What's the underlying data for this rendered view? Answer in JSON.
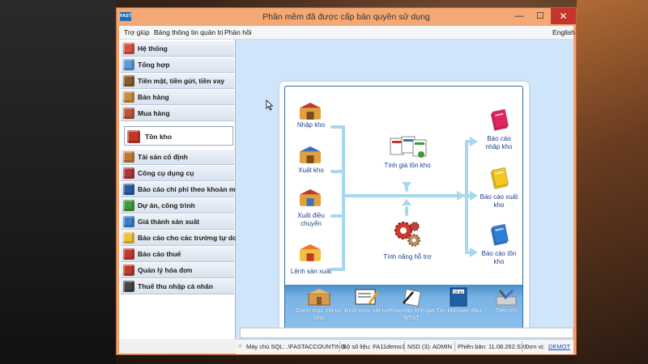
{
  "window": {
    "title": "Phần mềm đã được cấp bản quyền sử dụng",
    "app_icon_text": "FAST",
    "minimize": "—",
    "maximize": "☐",
    "close": "✕"
  },
  "menubar": {
    "items": [
      "Trợ giúp",
      "Bảng thông tin quản trị",
      "Phản hồi"
    ],
    "language": "English"
  },
  "sidebar": {
    "items": [
      {
        "label": "Hệ thống",
        "icon": "system-icon",
        "color": "#d9503f"
      },
      {
        "label": "Tổng hợp",
        "icon": "summary-icon",
        "color": "#5a9ad6"
      },
      {
        "label": "Tiền mặt, tiền gửi, tiền vay",
        "icon": "cash-icon",
        "color": "#8a5a2a"
      },
      {
        "label": "Bán hàng",
        "icon": "sales-icon",
        "color": "#c98a3a"
      },
      {
        "label": "Mua hàng",
        "icon": "purchase-icon",
        "color": "#b9553a"
      },
      {
        "label": "Tồn kho",
        "icon": "inventory-icon",
        "color": "#c0392b",
        "selected": true
      },
      {
        "label": "Tài sản cố định",
        "icon": "fixed-asset-icon",
        "color": "#c07a30"
      },
      {
        "label": "Công cụ dụng cụ",
        "icon": "tools-icon",
        "color": "#b0353a"
      },
      {
        "label": "Báo cáo chi phí theo khoản mục",
        "icon": "expense-report-icon",
        "color": "#2c5aa0"
      },
      {
        "label": "Dự án, công trình",
        "icon": "project-icon",
        "color": "#3f9a3a"
      },
      {
        "label": "Giá thành sản xuất",
        "icon": "production-cost-icon",
        "color": "#3b7fc6"
      },
      {
        "label": "Báo cáo cho các trường tự do",
        "icon": "custom-report-icon",
        "color": "#e8c23a"
      },
      {
        "label": "Báo cáo thuế",
        "icon": "tax-report-icon",
        "color": "#c0392b"
      },
      {
        "label": "Quản lý hóa đơn",
        "icon": "invoice-icon",
        "color": "#c0392b"
      },
      {
        "label": "Thuế thu nhập cá nhân",
        "icon": "personal-tax-icon",
        "color": "#444444"
      }
    ]
  },
  "flow": {
    "left": [
      {
        "label": "Nhập kho",
        "icon": "import-stock-icon"
      },
      {
        "label": "Xuất kho",
        "icon": "export-stock-icon"
      },
      {
        "label": "Xuất điều chuyển",
        "icon": "transfer-stock-icon"
      },
      {
        "label": "Lệnh sản xuất",
        "icon": "production-order-icon"
      }
    ],
    "center": [
      {
        "label": "Tính giá tồn kho",
        "icon": "inventory-valuation-icon"
      },
      {
        "label": "Tính năng hỗ trợ",
        "icon": "support-features-icon"
      }
    ],
    "right": [
      {
        "label": "Báo cáo nhập kho",
        "icon": "import-report-icon",
        "color": "#e0245e"
      },
      {
        "label": "Báo cáo xuất kho",
        "icon": "export-report-icon",
        "color": "#f2c81e"
      },
      {
        "label": "Báo cáo tồn kho",
        "icon": "stock-report-icon",
        "color": "#2e7fd6"
      }
    ]
  },
  "toolbar": {
    "items": [
      {
        "label": "Danh mục vật tư, kho",
        "icon": "material-catalog-icon"
      },
      {
        "label": "Định mức vật tư",
        "icon": "material-norm-icon"
      },
      {
        "label": "Khai báo tính giá NTXT",
        "icon": "fifo-declare-icon"
      },
      {
        "label": "Tồn kho ban đầu",
        "icon": "opening-stock-icon",
        "badge": "Số dư"
      },
      {
        "label": "Tiện ích",
        "icon": "utilities-icon"
      }
    ]
  },
  "statusbar": {
    "server_label": "Máy chủ SQL: .\\FASTACCOUNTING",
    "database_label": "Bộ số liệu: FA11demo1",
    "user_label": "NSD (3): ADMIN",
    "version_label": "Phiên bản: 11.08.262.SX",
    "unit_prefix": "Đơn vị:",
    "unit_value": "DEMOT"
  }
}
